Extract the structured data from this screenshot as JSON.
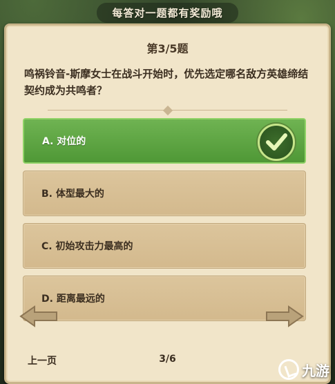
{
  "banner": {
    "text": "每答对一题都有奖励哦"
  },
  "question": {
    "number": "第3/5题",
    "text": "鸣祸铃音-斯摩女士在战斗开始时，优先选定哪名敌方英雄缔结契约成为共鸣者？"
  },
  "options": [
    {
      "label": "A. 对位的",
      "state": "correct"
    },
    {
      "label": "B. 体型最大的",
      "state": "normal"
    },
    {
      "label": "C. 初始攻击力最高的",
      "state": "normal"
    },
    {
      "label": "D. 距离最远的",
      "state": "normal"
    }
  ],
  "navigation": {
    "prev_label": "上一页",
    "page_indicator": "3/6"
  },
  "watermark": {
    "text": "九游"
  },
  "colors": {
    "correct_fill": "#5ea643",
    "option_fill": "#d8c095",
    "card_bg": "#f1e5c9",
    "text": "#3b2e20"
  },
  "icons": {
    "correct_mark": "checkmark-icon",
    "prev": "arrow-left-icon",
    "next": "arrow-right-icon"
  }
}
